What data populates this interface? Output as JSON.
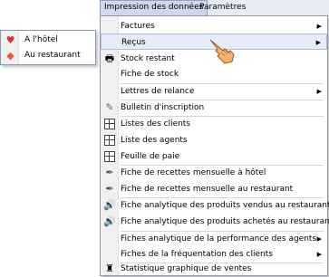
{
  "menubar": {
    "items": [
      "Impression des données",
      "Paramètres"
    ]
  },
  "main_menu": {
    "items": [
      {
        "label": "Factures",
        "icon": "",
        "submenu": true
      },
      {
        "label": "Reçus",
        "icon": "",
        "submenu": true,
        "highlighted": true
      },
      {
        "label": "Stock restant",
        "icon": "print-icon"
      },
      {
        "label": "Fiche de stock",
        "icon": ""
      },
      {
        "label": "Lettres de relance",
        "icon": "",
        "submenu": true
      },
      {
        "label": "Bulletin d'inscription",
        "icon": "pen-icon"
      },
      {
        "label": "Listes des clients",
        "icon": "grid-icon"
      },
      {
        "label": "Liste des agents",
        "icon": "grid-icon"
      },
      {
        "label": "Feuille de paie",
        "icon": "grid-icon"
      },
      {
        "label": "Fiche de recettes mensuelle à hôtel",
        "icon": "wrench-icon"
      },
      {
        "label": "Fiche de recettes mensuelle au restaurant",
        "icon": "wrench-icon"
      },
      {
        "label": "Fiche analytique des produits vendus au restaurant",
        "icon": "signal-icon"
      },
      {
        "label": "Fiche analytique des produits achetés au restaurant",
        "icon": "signal-icon"
      },
      {
        "label": "Fiches analytique de la performance des agents",
        "icon": "",
        "submenu": true
      },
      {
        "label": "Fiches de la fréquentation des clients",
        "icon": "",
        "submenu": true
      },
      {
        "label": "Statistique graphique de ventes",
        "icon": "chart-icon"
      }
    ]
  },
  "sub_menu": {
    "items": [
      {
        "label": "A l'hôtel",
        "icon": "heart-icon",
        "color": "#d9342b"
      },
      {
        "label": "Au restaurant",
        "icon": "diamond-icon",
        "color": "#e8582a"
      }
    ]
  },
  "colors": {
    "menubar_bg": "#e8edf5",
    "highlight": "#e5ecf8",
    "highlight_border": "#a9bfe3"
  }
}
